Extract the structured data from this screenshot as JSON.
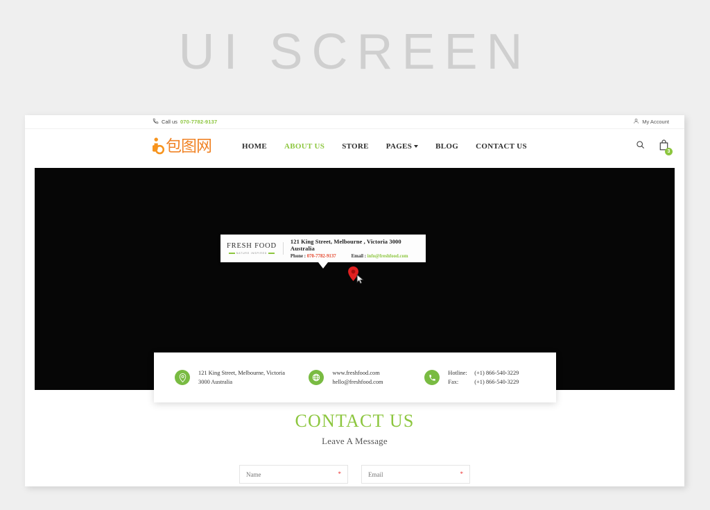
{
  "watermark": {
    "text": "UI SCREEN"
  },
  "topbar": {
    "call_label": "Call us",
    "phone": "070-7782-9137",
    "account_label": "My Account",
    "phone_icon": "phone-icon",
    "account_icon": "user-icon"
  },
  "brand": {
    "logo_text": "包图网",
    "logo_mark": "b-logo-icon"
  },
  "nav": {
    "items": [
      {
        "label": "HOME",
        "active": false,
        "dropdown": false
      },
      {
        "label": "ABOUT US",
        "active": true,
        "dropdown": false
      },
      {
        "label": "STORE",
        "active": false,
        "dropdown": false
      },
      {
        "label": "PAGES",
        "active": false,
        "dropdown": true
      },
      {
        "label": "BLOG",
        "active": false,
        "dropdown": false
      },
      {
        "label": "CONTACT US",
        "active": false,
        "dropdown": false
      }
    ],
    "search_icon": "search-icon",
    "cart_icon": "shopping-bag-icon",
    "cart_count": "3"
  },
  "map": {
    "marker_icon": "map-pin-icon",
    "cursor_icon": "cursor-icon",
    "infowindow": {
      "logo_name": "FRESH FOOD",
      "logo_tagline": "NATURE INSPIRED",
      "address": "121 King Street, Melbourne , Victoria 3000 Australia",
      "phone_label": "Phone :",
      "phone_value": "070-7782-9137",
      "email_label": "Email :",
      "email_value": "info@freshfood.com"
    }
  },
  "contact_card": {
    "address": {
      "icon": "location-pin-icon",
      "line1": "121 King Street, Melbourne, Victoria",
      "line2": "3000 Australia"
    },
    "web": {
      "icon": "globe-icon",
      "line1": "www.freshfood.com",
      "line2": "hello@freshfood.com"
    },
    "phone": {
      "icon": "phone-handset-icon",
      "hotline_label": "Hotline:",
      "hotline_value": "(+1) 866-540-3229",
      "fax_label": "Fax:",
      "fax_value": "(+1) 866-540-3229"
    }
  },
  "form": {
    "title": "CONTACT US",
    "subtitle": "Leave A Message",
    "name_placeholder": "Name",
    "email_placeholder": "Email",
    "required_mark": "*"
  },
  "colors": {
    "accent_green": "#8cc63e",
    "logo_orange": "#f08326",
    "required_red": "#ec2f2f",
    "map_black": "#060606",
    "page_bg": "#efefef"
  }
}
